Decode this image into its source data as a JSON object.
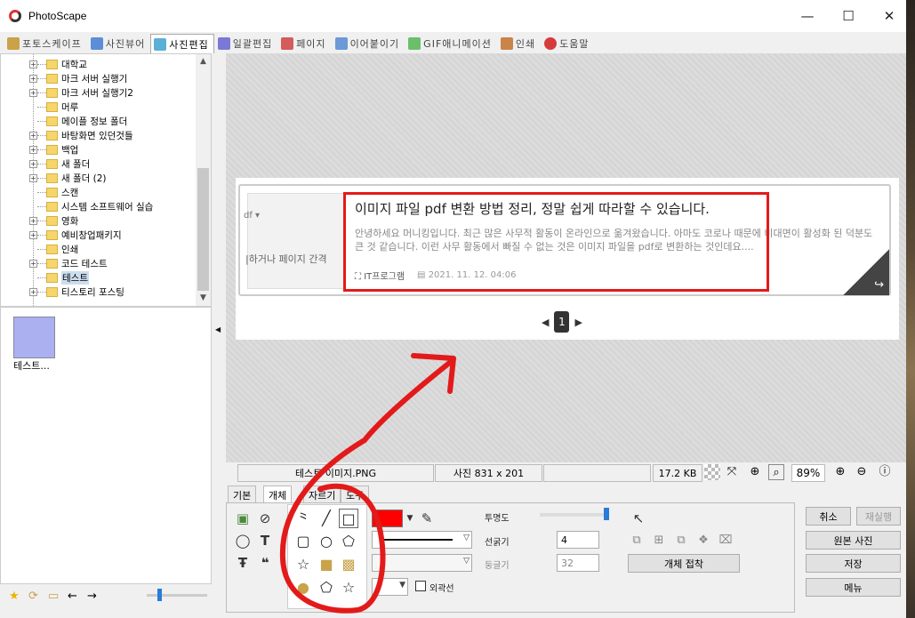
{
  "window": {
    "title": "PhotoScape",
    "minimize": "—",
    "maximize": "☐",
    "close": "✕"
  },
  "tabs": [
    {
      "label": "포토스케이프",
      "color": "#c9a24a"
    },
    {
      "label": "사진뷰어",
      "color": "#5b8ed6"
    },
    {
      "label": "사진편집",
      "color": "#5bb0d6"
    },
    {
      "label": "일괄편집",
      "color": "#7a7ad6"
    },
    {
      "label": "페이지",
      "color": "#d65b5b"
    },
    {
      "label": "이어붙이기",
      "color": "#6b9ad6"
    },
    {
      "label": "GIF애니메이션",
      "color": "#6bbf6b"
    },
    {
      "label": "인쇄",
      "color": "#c9844a"
    },
    {
      "label": "도움말",
      "color": "#d63b3b"
    }
  ],
  "tree": {
    "items": [
      {
        "label": "대학교",
        "expand": true
      },
      {
        "label": "마크 서버 실행기",
        "expand": true
      },
      {
        "label": "마크 서버 실행기2",
        "expand": true
      },
      {
        "label": "머루",
        "expand": false
      },
      {
        "label": "메이플 정보 폴더",
        "expand": false
      },
      {
        "label": "바탕화면 있던것들",
        "expand": true
      },
      {
        "label": "백업",
        "expand": true
      },
      {
        "label": "새 폴더",
        "expand": true
      },
      {
        "label": "새 폴더 (2)",
        "expand": true
      },
      {
        "label": "스캔",
        "expand": false
      },
      {
        "label": "시스템 소프트웨어 실습",
        "expand": false
      },
      {
        "label": "영화",
        "expand": true
      },
      {
        "label": "예비창업패키지",
        "expand": true
      },
      {
        "label": "인쇄",
        "expand": false
      },
      {
        "label": "코드 테스트",
        "expand": true
      },
      {
        "label": "테스트",
        "expand": false,
        "selected": true
      },
      {
        "label": "티스토리 포스팅",
        "expand": true
      }
    ]
  },
  "thumbnail": {
    "label": "테스트..."
  },
  "photo": {
    "left_text_1": "df ▾",
    "left_text_2": "|하거나 페이지 간격",
    "title": "이미지 파일 pdf 변환 방법 정리, 정말 쉽게 따라할 수 있습니다.",
    "body": "안녕하세요 머니킹입니다. 최근 많은 사무적 활동이 온라인으로 옮겨왔습니다. 아마도 코로나 때문에 비대면이 활성화 된 덕분도 큰 것 같습니다. 이런 사무 활동에서 빠질 수 없는 것은 이미지 파일을 pdf로 변환하는 것인데요....",
    "category": "IT프로그램",
    "date": "2021. 11. 12. 04:06",
    "page": "1"
  },
  "status": {
    "filename": "테스트 이미지.PNG",
    "size": "사진 831 x 201",
    "filesize": "17.2 KB",
    "zoom": "89%"
  },
  "panel_tabs": [
    "기본",
    "개체",
    "자르기",
    "도구"
  ],
  "controls": {
    "opacity_label": "투명도",
    "opacity_value": 1.0,
    "thickness_label": "선굵기",
    "thickness_value": "4",
    "roundness_label": "둥글기",
    "roundness_value": "32",
    "outline_label": "외곽선",
    "attach_button": "개체 접착",
    "fill_color": "#ff0000"
  },
  "buttons": {
    "cancel": "취소",
    "redo": "재실행",
    "original": "원본 사진",
    "save": "저장",
    "menu": "메뉴"
  }
}
